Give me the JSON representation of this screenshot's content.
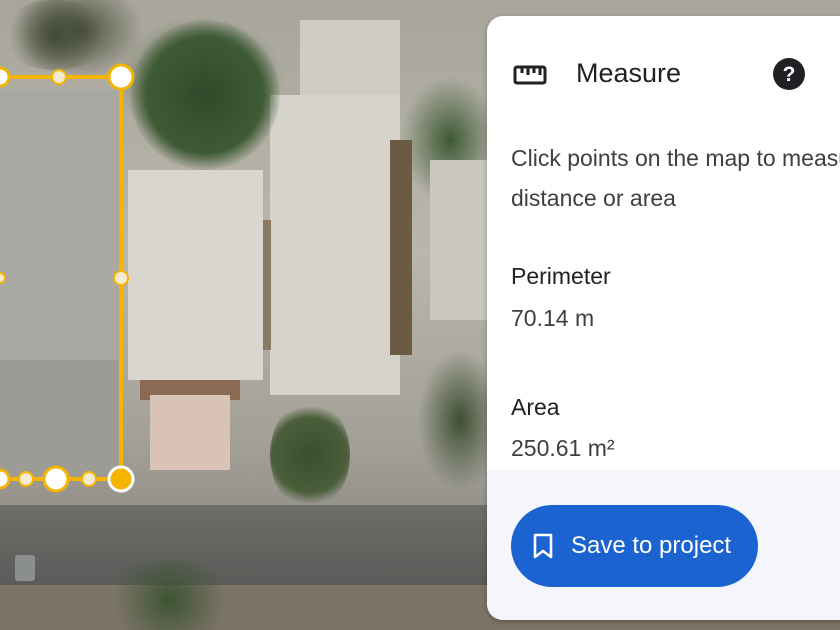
{
  "colors": {
    "measure_line": "#f4b400",
    "vertex_fill": "#ffffff",
    "active_vertex_fill": "#f4b400",
    "button_bg": "#1a63d1",
    "panel_bg": "#ffffff",
    "footer_bg": "#f4f6fb"
  },
  "panel": {
    "title": "Measure",
    "title_icon": "ruler-icon",
    "help_icon": "help-circle-icon",
    "instructions": "Click points on the map to measure distance or area",
    "perimeter": {
      "label": "Perimeter",
      "value": "70.14 m"
    },
    "area": {
      "label": "Area",
      "value": "250.61 m²"
    },
    "save_button": {
      "icon": "bookmark-icon",
      "label": "Save to project"
    }
  }
}
